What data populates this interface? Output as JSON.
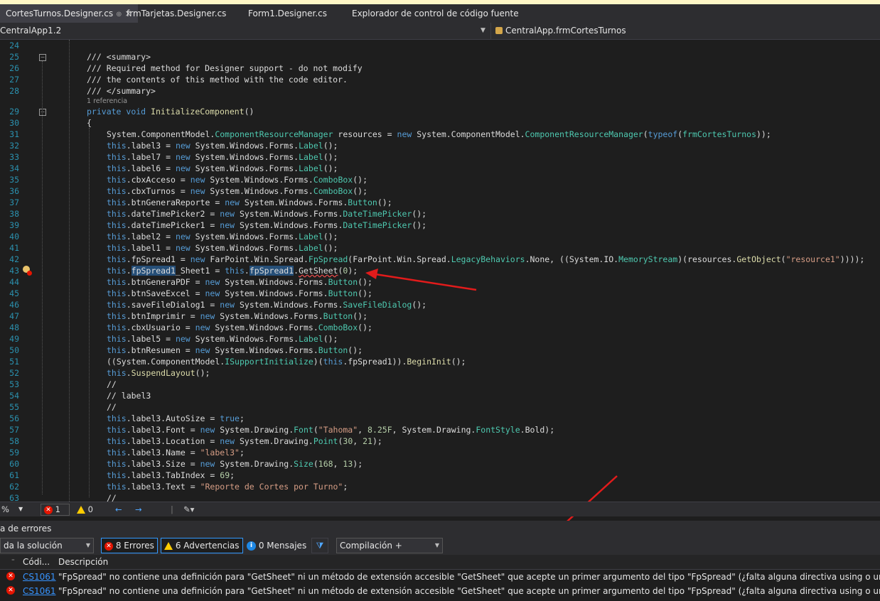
{
  "tabs": [
    {
      "label": "CortesTurnos.Designer.cs",
      "active": true,
      "pin": "⊕",
      "close": "×"
    },
    {
      "label": "frmTarjetas.Designer.cs"
    },
    {
      "label": "Form1.Designer.cs"
    },
    {
      "label": "Explorador de control de código fuente"
    }
  ],
  "nav": {
    "project": "CentralApp1.2",
    "member": "CentralApp.frmCortesTurnos"
  },
  "editor": {
    "reference_lens": "1 referencia",
    "lines": [
      24,
      25,
      26,
      27,
      28,
      29,
      30,
      31,
      32,
      33,
      34,
      35,
      36,
      37,
      38,
      39,
      40,
      41,
      42,
      43,
      44,
      45,
      46,
      47,
      48,
      49,
      50,
      51,
      52,
      53,
      54,
      55,
      56,
      57,
      58,
      59,
      60,
      61,
      62,
      63
    ]
  },
  "status": {
    "zoom": "%",
    "errors": "1",
    "warnings": "0"
  },
  "error_list": {
    "title": "a de errores",
    "scope": "da la solución",
    "errors_btn": "8 Errores",
    "warnings_btn": "6 Advertencias",
    "messages_btn": "0 Mensajes",
    "build_filter": "Compilación + IntelliSen",
    "col_code": "Códi...",
    "col_desc": "Descripción",
    "rows": [
      {
        "code": "CS1061",
        "description": "\"FpSpread\" no contiene una definición para \"GetSheet\" ni un método de extensión accesible \"GetSheet\" que acepte un primer argumento del tipo \"FpSpread\" (¿falta alguna directiva using o una referencia de ensamblado"
      },
      {
        "code": "CS1061",
        "description": "\"FpSpread\" no contiene una definición para \"GetSheet\" ni un método de extensión accesible \"GetSheet\" que acepte un primer argumento del tipo \"FpSpread\" (¿falta alguna directiva using o una referencia de ensamblado"
      }
    ]
  },
  "colors": {
    "accent": "#007acc",
    "error": "#e51400",
    "arrow": "#e21b1b",
    "keyword": "#569cd6",
    "type": "#4ec9b0",
    "string": "#d69d85",
    "comment": "#57a64a"
  }
}
